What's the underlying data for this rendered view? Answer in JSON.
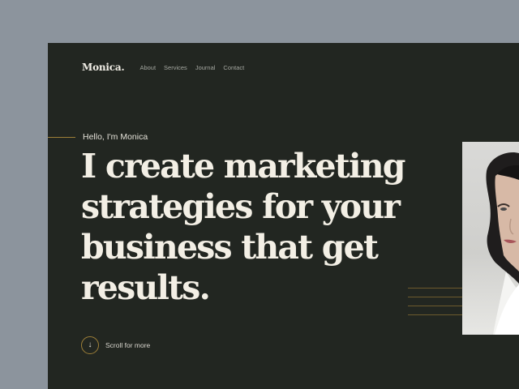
{
  "nav": {
    "brand": "Monica.",
    "links": [
      "About",
      "Services",
      "Journal",
      "Contact"
    ]
  },
  "hero": {
    "greeting": "Hello, I'm Monica",
    "headline_lines": [
      "I create marketing",
      "strategies for your",
      "business that get",
      "results."
    ],
    "portrait_alt": "Portrait of Monica"
  },
  "scroll": {
    "icon": "arrow-down-icon",
    "label": "Scroll for more"
  },
  "colors": {
    "background": "#222621",
    "canvas": "#8c949d",
    "accent": "#9e7f38",
    "headline": "#f3efe5"
  }
}
